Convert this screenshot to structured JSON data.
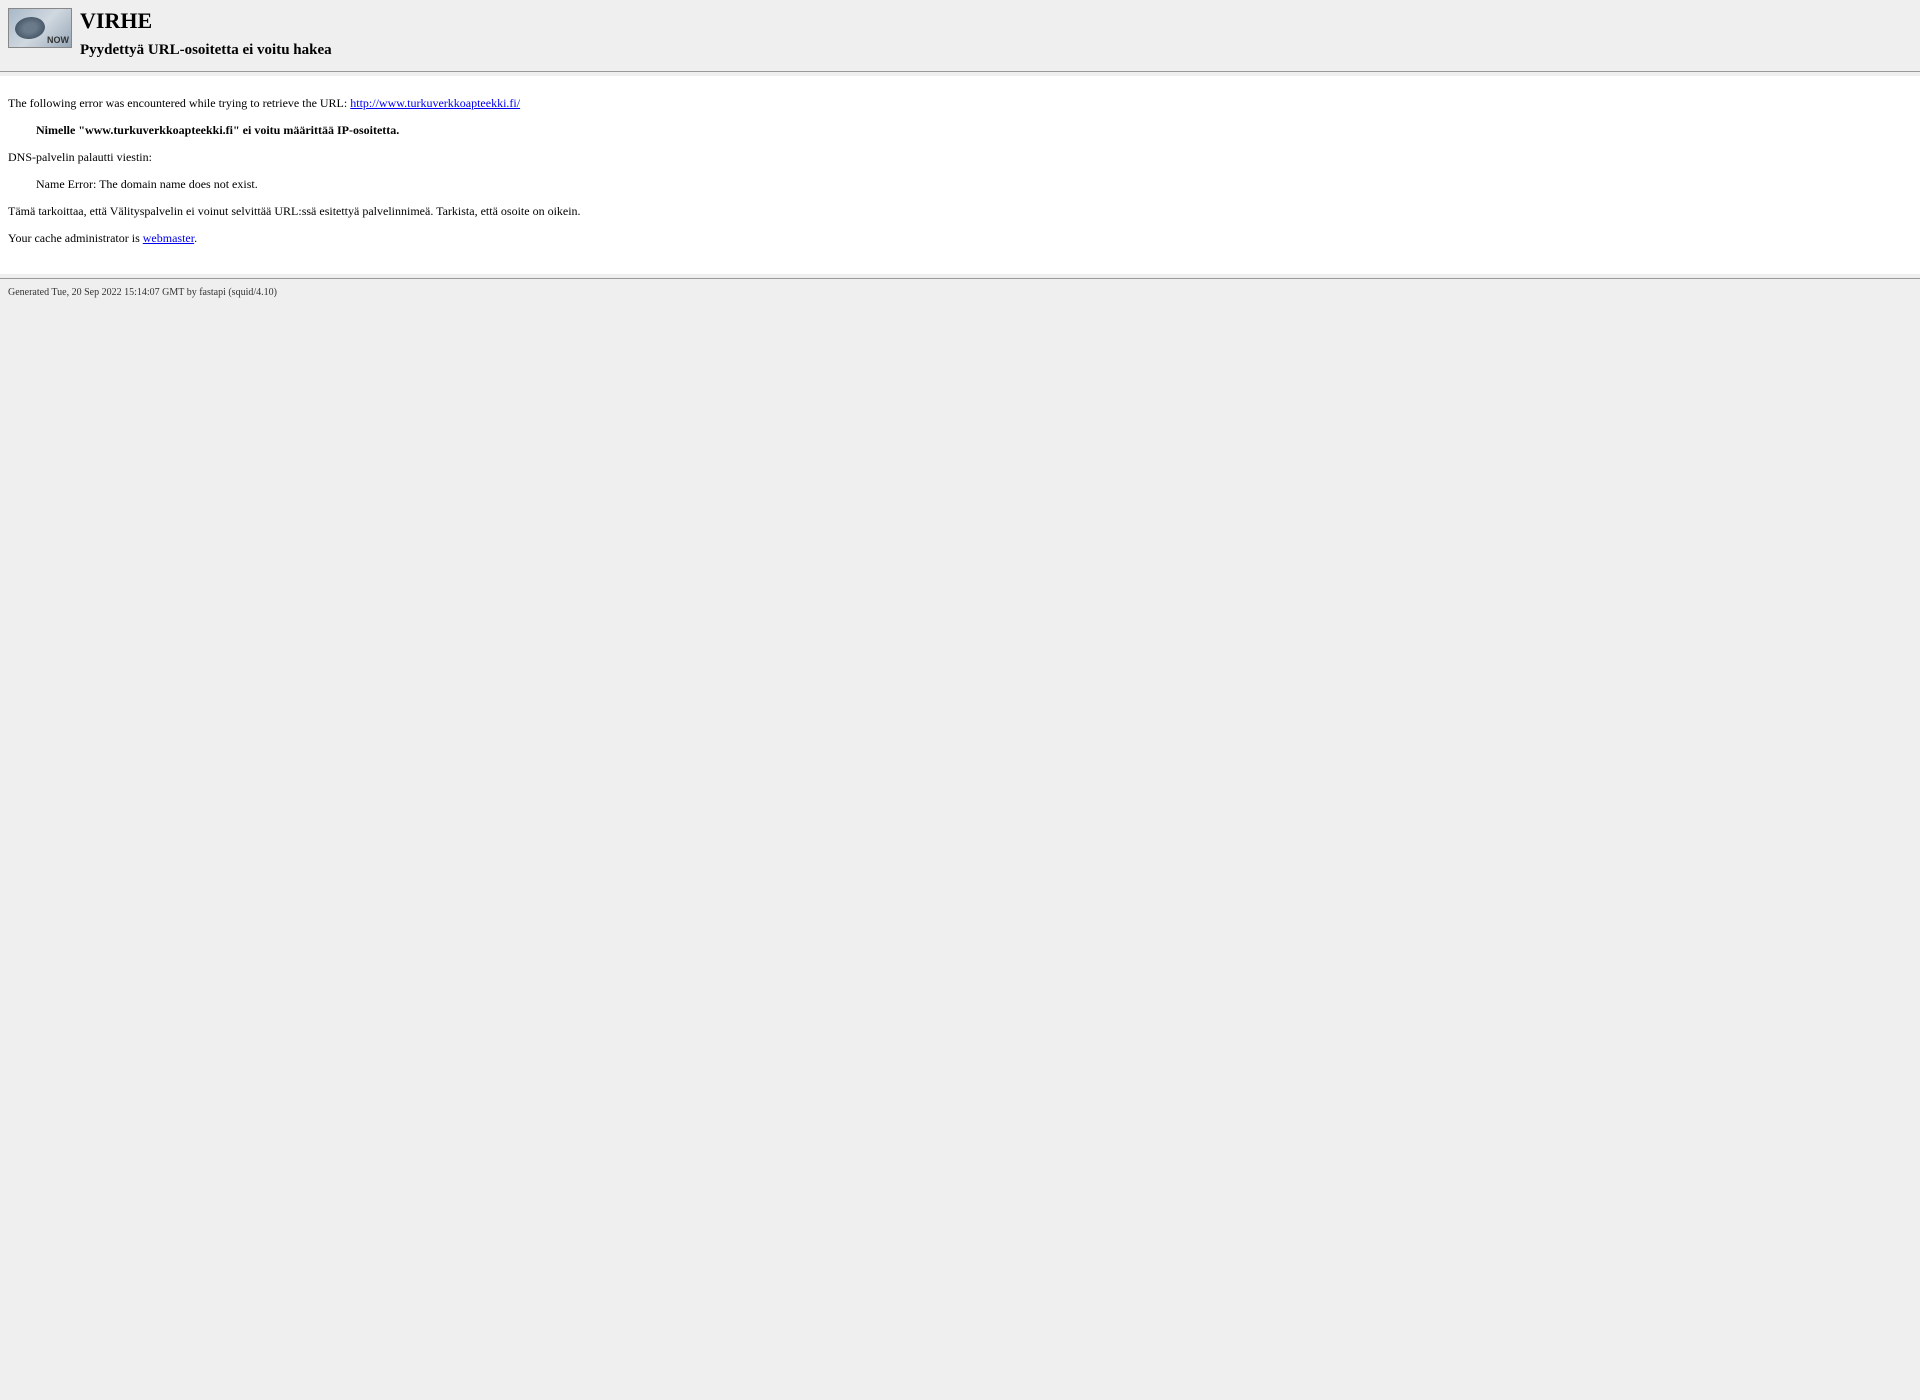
{
  "header": {
    "title": "VIRHE",
    "subtitle": "Pyydettyä URL-osoitetta ei voitu hakea"
  },
  "content": {
    "error_intro": "The following error was encountered while trying to retrieve the URL: ",
    "url": "http://www.turkuverkkoapteekki.fi/",
    "dns_error": "Nimelle \"www.turkuverkkoapteekki.fi\" ei voitu määrittää IP-osoitetta.",
    "dns_returned": "DNS-palvelin palautti viestin:",
    "name_error": "Name Error: The domain name does not exist.",
    "explanation": "Tämä tarkoittaa, että Välityspalvelin ei voinut selvittää URL:ssä esitettyä palvelinnimeä. Tarkista, että osoite on oikein.",
    "admin_intro": "Your cache administrator is ",
    "admin_link": "webmaster",
    "admin_suffix": "."
  },
  "footer": {
    "generated": "Generated Tue, 20 Sep 2022 15:14:07 GMT by fastapi (squid/4.10)"
  }
}
